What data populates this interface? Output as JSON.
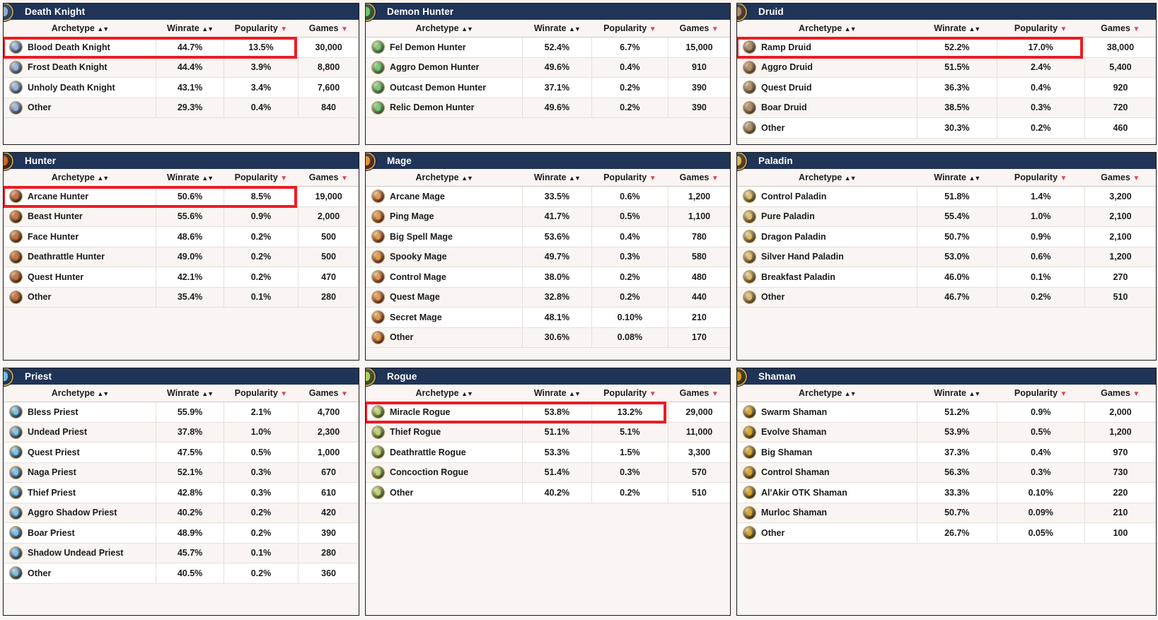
{
  "columns": {
    "archetype": "Archetype",
    "winrate": "Winrate",
    "popularity": "Popularity",
    "games": "Games",
    "sort_both_icon": "sort-both-icon",
    "sort_desc_icon": "sort-desc-icon"
  },
  "colors": {
    "header_bar": "#203458",
    "panel_bg": "#faf5f2",
    "row_alt": "#ffffff",
    "highlight_border": "#ec1c24",
    "winrate_green": "#1aa82c",
    "winrate_amber": "#d99a12",
    "winrate_orange": "#ef7038",
    "winrate_red": "#f8645f",
    "sort_arrow_red": "#d9455a"
  },
  "panels": [
    {
      "id": "death-knight",
      "title": "Death Knight",
      "crest": {
        "ring": "#b99a5b",
        "bg": "#2c3f5e",
        "sigil": "#9fb6d8"
      },
      "highlight_row": 0,
      "rows": [
        {
          "archetype": "Blood Death Knight",
          "winrate": "44.7%",
          "wr_class": "wr-red",
          "popularity": "13.5%",
          "games": "30,000"
        },
        {
          "archetype": "Frost Death Knight",
          "winrate": "44.4%",
          "wr_class": "wr-red",
          "popularity": "3.9%",
          "games": "8,800"
        },
        {
          "archetype": "Unholy Death Knight",
          "winrate": "43.1%",
          "wr_class": "wr-red",
          "popularity": "3.4%",
          "games": "7,600"
        },
        {
          "archetype": "Other",
          "winrate": "29.3%",
          "wr_class": "wr-red",
          "popularity": "0.4%",
          "games": "840"
        }
      ]
    },
    {
      "id": "demon-hunter",
      "title": "Demon Hunter",
      "crest": {
        "ring": "#b99a5b",
        "bg": "#2f5230",
        "sigil": "#7ad06a"
      },
      "highlight_row": null,
      "rows": [
        {
          "archetype": "Fel Demon Hunter",
          "winrate": "52.4%",
          "wr_class": "wr-green",
          "popularity": "6.7%",
          "games": "15,000"
        },
        {
          "archetype": "Aggro Demon Hunter",
          "winrate": "49.6%",
          "wr_class": "wr-amber",
          "popularity": "0.4%",
          "games": "910"
        },
        {
          "archetype": "Outcast Demon Hunter",
          "winrate": "37.1%",
          "wr_class": "wr-red",
          "popularity": "0.2%",
          "games": "390"
        },
        {
          "archetype": "Relic Demon Hunter",
          "winrate": "49.6%",
          "wr_class": "wr-amber",
          "popularity": "0.2%",
          "games": "390"
        }
      ]
    },
    {
      "id": "druid",
      "title": "Druid",
      "crest": {
        "ring": "#b99a5b",
        "bg": "#4a3726",
        "sigil": "#b78f63"
      },
      "highlight_row": 0,
      "rows": [
        {
          "archetype": "Ramp Druid",
          "winrate": "52.2%",
          "wr_class": "wr-green",
          "popularity": "17.0%",
          "games": "38,000"
        },
        {
          "archetype": "Aggro Druid",
          "winrate": "51.5%",
          "wr_class": "wr-green",
          "popularity": "2.4%",
          "games": "5,400"
        },
        {
          "archetype": "Quest Druid",
          "winrate": "36.3%",
          "wr_class": "wr-red",
          "popularity": "0.4%",
          "games": "920"
        },
        {
          "archetype": "Boar Druid",
          "winrate": "38.5%",
          "wr_class": "wr-red",
          "popularity": "0.3%",
          "games": "720"
        },
        {
          "archetype": "Other",
          "winrate": "30.3%",
          "wr_class": "wr-red",
          "popularity": "0.2%",
          "games": "460"
        }
      ]
    },
    {
      "id": "hunter",
      "title": "Hunter",
      "crest": {
        "ring": "#b99a5b",
        "bg": "#3a2416",
        "sigil": "#d86f2a"
      },
      "highlight_row": 0,
      "rows": [
        {
          "archetype": "Arcane Hunter",
          "winrate": "50.6%",
          "wr_class": "wr-green",
          "popularity": "8.5%",
          "games": "19,000"
        },
        {
          "archetype": "Beast Hunter",
          "winrate": "55.6%",
          "wr_class": "wr-green",
          "popularity": "0.9%",
          "games": "2,000"
        },
        {
          "archetype": "Face Hunter",
          "winrate": "48.6%",
          "wr_class": "wr-orange",
          "popularity": "0.2%",
          "games": "500"
        },
        {
          "archetype": "Deathrattle Hunter",
          "winrate": "49.0%",
          "wr_class": "wr-amber",
          "popularity": "0.2%",
          "games": "500"
        },
        {
          "archetype": "Quest Hunter",
          "winrate": "42.1%",
          "wr_class": "wr-red",
          "popularity": "0.2%",
          "games": "470"
        },
        {
          "archetype": "Other",
          "winrate": "35.4%",
          "wr_class": "wr-red",
          "popularity": "0.1%",
          "games": "280"
        }
      ]
    },
    {
      "id": "mage",
      "title": "Mage",
      "crest": {
        "ring": "#b99a5b",
        "bg": "#5a2217",
        "sigil": "#e8a13a"
      },
      "highlight_row": null,
      "rows": [
        {
          "archetype": "Arcane Mage",
          "winrate": "33.5%",
          "wr_class": "wr-red",
          "popularity": "0.6%",
          "games": "1,200"
        },
        {
          "archetype": "Ping Mage",
          "winrate": "41.7%",
          "wr_class": "wr-red",
          "popularity": "0.5%",
          "games": "1,100"
        },
        {
          "archetype": "Big Spell Mage",
          "winrate": "53.6%",
          "wr_class": "wr-green",
          "popularity": "0.4%",
          "games": "780"
        },
        {
          "archetype": "Spooky Mage",
          "winrate": "49.7%",
          "wr_class": "wr-amber",
          "popularity": "0.3%",
          "games": "580"
        },
        {
          "archetype": "Control Mage",
          "winrate": "38.0%",
          "wr_class": "wr-red",
          "popularity": "0.2%",
          "games": "480"
        },
        {
          "archetype": "Quest Mage",
          "winrate": "32.8%",
          "wr_class": "wr-red",
          "popularity": "0.2%",
          "games": "440"
        },
        {
          "archetype": "Secret Mage",
          "winrate": "48.1%",
          "wr_class": "wr-orange",
          "popularity": "0.10%",
          "games": "210"
        },
        {
          "archetype": "Other",
          "winrate": "30.6%",
          "wr_class": "wr-red",
          "popularity": "0.08%",
          "games": "170"
        }
      ]
    },
    {
      "id": "paladin",
      "title": "Paladin",
      "crest": {
        "ring": "#b99a5b",
        "bg": "#4d3a18",
        "sigil": "#e5c36a"
      },
      "highlight_row": null,
      "rows": [
        {
          "archetype": "Control Paladin",
          "winrate": "51.8%",
          "wr_class": "wr-green",
          "popularity": "1.4%",
          "games": "3,200"
        },
        {
          "archetype": "Pure Paladin",
          "winrate": "55.4%",
          "wr_class": "wr-green",
          "popularity": "1.0%",
          "games": "2,100"
        },
        {
          "archetype": "Dragon Paladin",
          "winrate": "50.7%",
          "wr_class": "wr-green",
          "popularity": "0.9%",
          "games": "2,100"
        },
        {
          "archetype": "Silver Hand Paladin",
          "winrate": "53.0%",
          "wr_class": "wr-green",
          "popularity": "0.6%",
          "games": "1,200"
        },
        {
          "archetype": "Breakfast Paladin",
          "winrate": "46.0%",
          "wr_class": "wr-orange",
          "popularity": "0.1%",
          "games": "270"
        },
        {
          "archetype": "Other",
          "winrate": "46.7%",
          "wr_class": "wr-orange",
          "popularity": "0.2%",
          "games": "510"
        }
      ]
    },
    {
      "id": "priest",
      "title": "Priest",
      "crest": {
        "ring": "#b99a5b",
        "bg": "#21334a",
        "sigil": "#7fc8e8"
      },
      "highlight_row": null,
      "rows": [
        {
          "archetype": "Bless Priest",
          "winrate": "55.9%",
          "wr_class": "wr-green",
          "popularity": "2.1%",
          "games": "4,700"
        },
        {
          "archetype": "Undead Priest",
          "winrate": "37.8%",
          "wr_class": "wr-red",
          "popularity": "1.0%",
          "games": "2,300"
        },
        {
          "archetype": "Quest Priest",
          "winrate": "47.5%",
          "wr_class": "wr-orange",
          "popularity": "0.5%",
          "games": "1,000"
        },
        {
          "archetype": "Naga Priest",
          "winrate": "52.1%",
          "wr_class": "wr-green",
          "popularity": "0.3%",
          "games": "670"
        },
        {
          "archetype": "Thief Priest",
          "winrate": "42.8%",
          "wr_class": "wr-red",
          "popularity": "0.3%",
          "games": "610"
        },
        {
          "archetype": "Aggro Shadow Priest",
          "winrate": "40.2%",
          "wr_class": "wr-red",
          "popularity": "0.2%",
          "games": "420"
        },
        {
          "archetype": "Boar Priest",
          "winrate": "48.9%",
          "wr_class": "wr-amber",
          "popularity": "0.2%",
          "games": "390"
        },
        {
          "archetype": "Shadow Undead Priest",
          "winrate": "45.7%",
          "wr_class": "wr-orange",
          "popularity": "0.1%",
          "games": "280"
        },
        {
          "archetype": "Other",
          "winrate": "40.5%",
          "wr_class": "wr-red",
          "popularity": "0.2%",
          "games": "360"
        }
      ]
    },
    {
      "id": "rogue",
      "title": "Rogue",
      "crest": {
        "ring": "#b99a5b",
        "bg": "#3c4a22",
        "sigil": "#c3d86a"
      },
      "highlight_row": 0,
      "rows": [
        {
          "archetype": "Miracle Rogue",
          "winrate": "53.8%",
          "wr_class": "wr-green",
          "popularity": "13.2%",
          "games": "29,000"
        },
        {
          "archetype": "Thief Rogue",
          "winrate": "51.1%",
          "wr_class": "wr-green",
          "popularity": "5.1%",
          "games": "11,000"
        },
        {
          "archetype": "Deathrattle Rogue",
          "winrate": "53.3%",
          "wr_class": "wr-green",
          "popularity": "1.5%",
          "games": "3,300"
        },
        {
          "archetype": "Concoction Rogue",
          "winrate": "51.4%",
          "wr_class": "wr-green",
          "popularity": "0.3%",
          "games": "570"
        },
        {
          "archetype": "Other",
          "winrate": "40.2%",
          "wr_class": "wr-red",
          "popularity": "0.2%",
          "games": "510"
        }
      ]
    },
    {
      "id": "shaman",
      "title": "Shaman",
      "crest": {
        "ring": "#b99a5b",
        "bg": "#3d2f10",
        "sigil": "#e3a91e"
      },
      "highlight_row": null,
      "rows": [
        {
          "archetype": "Swarm Shaman",
          "winrate": "51.2%",
          "wr_class": "wr-green",
          "popularity": "0.9%",
          "games": "2,000"
        },
        {
          "archetype": "Evolve Shaman",
          "winrate": "53.9%",
          "wr_class": "wr-green",
          "popularity": "0.5%",
          "games": "1,200"
        },
        {
          "archetype": "Big Shaman",
          "winrate": "37.3%",
          "wr_class": "wr-red",
          "popularity": "0.4%",
          "games": "970"
        },
        {
          "archetype": "Control Shaman",
          "winrate": "56.3%",
          "wr_class": "wr-green",
          "popularity": "0.3%",
          "games": "730"
        },
        {
          "archetype": "Al'Akir OTK Shaman",
          "winrate": "33.3%",
          "wr_class": "wr-red",
          "popularity": "0.10%",
          "games": "220"
        },
        {
          "archetype": "Murloc Shaman",
          "winrate": "50.7%",
          "wr_class": "wr-green",
          "popularity": "0.09%",
          "games": "210"
        },
        {
          "archetype": "Other",
          "winrate": "26.7%",
          "wr_class": "wr-red",
          "popularity": "0.05%",
          "games": "100"
        }
      ]
    }
  ]
}
